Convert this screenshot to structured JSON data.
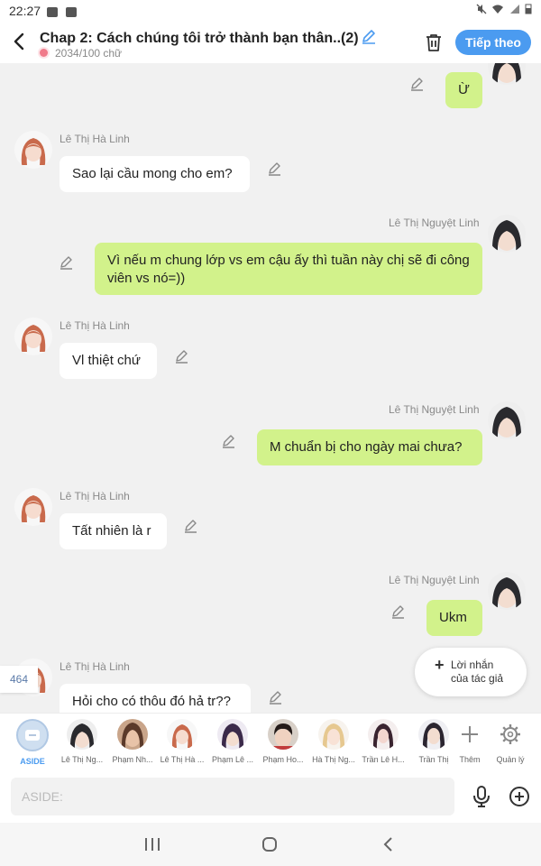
{
  "status_bar": {
    "time": "22:27"
  },
  "header": {
    "title": "Chap 2: Cách chúng tôi trở thành bạn thân..(2)",
    "word_count": "2034/100 chữ",
    "next_button": "Tiếp theo"
  },
  "messages": [
    {
      "side": "right",
      "sender": "",
      "text": "Ừ"
    },
    {
      "side": "left",
      "sender": "Lê Thị Hà Linh",
      "text": "Sao lại cầu mong cho em?"
    },
    {
      "side": "right",
      "sender": "Lê Thị Nguyệt Linh",
      "text": "Vì nếu m chung lớp vs em cậu ấy thì tuần này chị sẽ đi công viên vs nó=))"
    },
    {
      "side": "left",
      "sender": "Lê Thị Hà Linh",
      "text": "Vl thiệt chứ"
    },
    {
      "side": "right",
      "sender": "Lê Thị Nguyệt Linh",
      "text": "M chuẩn bị cho ngày mai chưa?"
    },
    {
      "side": "left",
      "sender": "Lê Thị Hà Linh",
      "text": "Tất nhiên là r"
    },
    {
      "side": "right",
      "sender": "Lê Thị Nguyệt Linh",
      "text": "Ukm"
    },
    {
      "side": "left",
      "sender": "Lê Thị Hà Linh",
      "text": "Hỏi cho có thôu đó hả tr??"
    }
  ],
  "counter": "464",
  "author_message_button": {
    "line1": "Lời nhắn",
    "line2": "của tác giả"
  },
  "characters": [
    {
      "name": "ASIDE"
    },
    {
      "name": "Lê Thị Ng..."
    },
    {
      "name": "Phạm Nh..."
    },
    {
      "name": "Lê Thị Hà ..."
    },
    {
      "name": "Phạm Lê ..."
    },
    {
      "name": "Phạm Ho..."
    },
    {
      "name": "Hà Thị Ng..."
    },
    {
      "name": "Trần Lê H..."
    },
    {
      "name": "Trần Thị"
    },
    {
      "name": "Thêm"
    },
    {
      "name": "Quản lý"
    }
  ],
  "input": {
    "placeholder": "ASIDE:"
  },
  "colors": {
    "accent": "#4b9bf0",
    "right_bubble": "#d2f28b",
    "left_bubble": "#ffffff",
    "background": "#f1f1f1"
  }
}
